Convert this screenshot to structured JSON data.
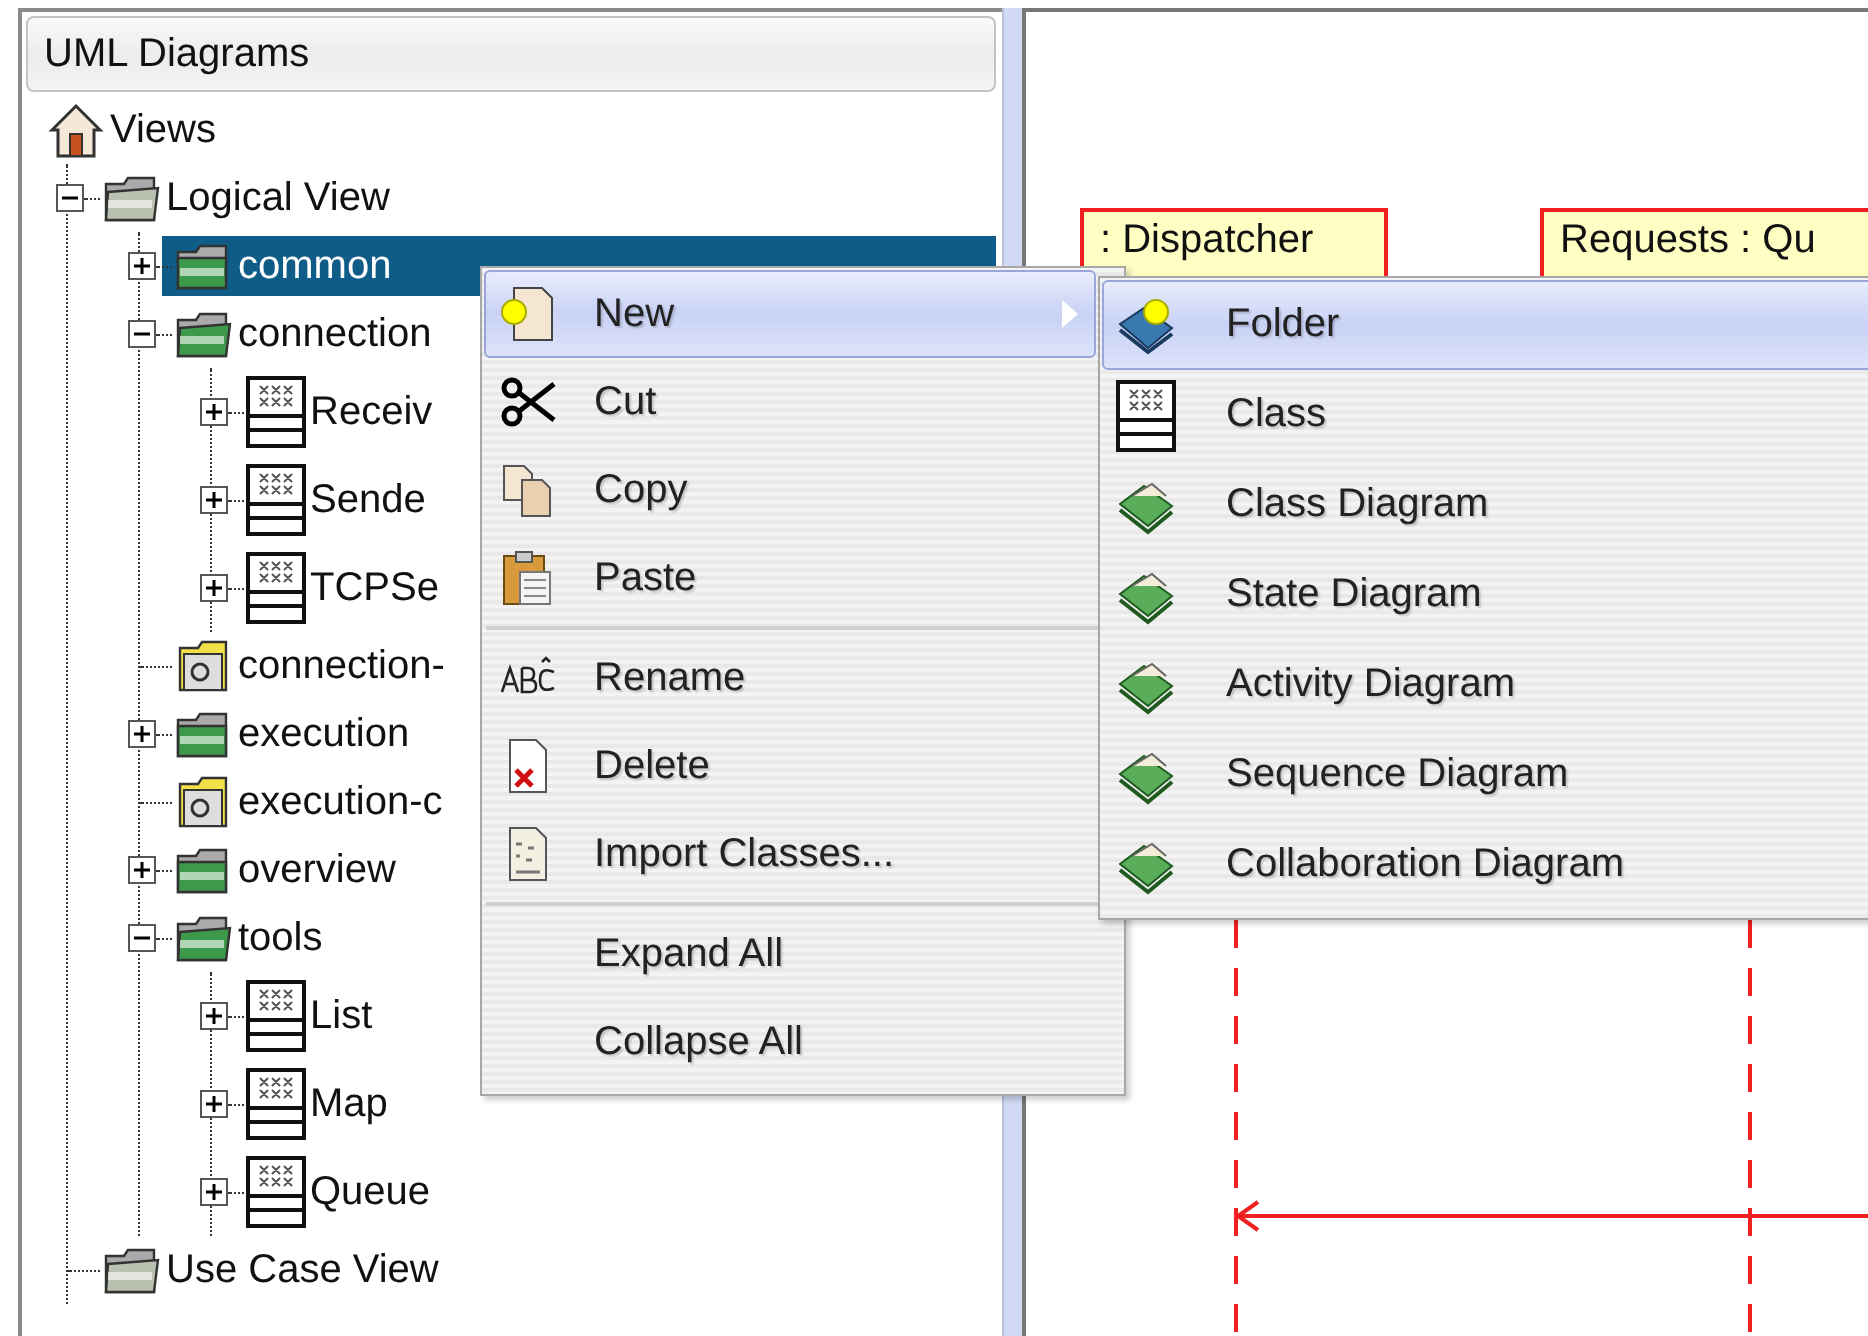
{
  "panel": {
    "title": "UML Diagrams"
  },
  "tree": [
    {
      "label": "Views",
      "kind": "root",
      "selected": false,
      "children": [
        {
          "label": "Logical View",
          "kind": "view",
          "expanded": true,
          "selected": false,
          "children": [
            {
              "label": "common",
              "kind": "package",
              "expanded": false,
              "selected": true
            },
            {
              "label": "connection",
              "kind": "package",
              "expanded": true,
              "selected": false,
              "children": [
                {
                  "label": "Receiv",
                  "kind": "class",
                  "expanded": false,
                  "selected": false
                },
                {
                  "label": "Sende",
                  "kind": "class",
                  "expanded": false,
                  "selected": false
                },
                {
                  "label": "TCPSe",
                  "kind": "class",
                  "expanded": false,
                  "selected": false
                }
              ]
            },
            {
              "label": "connection-",
              "kind": "classes",
              "selected": false
            },
            {
              "label": "execution",
              "kind": "package",
              "expanded": false,
              "selected": false
            },
            {
              "label": "execution-c",
              "kind": "classes",
              "selected": false
            },
            {
              "label": "overview",
              "kind": "package",
              "expanded": false,
              "selected": false
            },
            {
              "label": "tools",
              "kind": "package",
              "expanded": true,
              "selected": false,
              "children": [
                {
                  "label": "List",
                  "kind": "class",
                  "expanded": false,
                  "selected": false
                },
                {
                  "label": "Map",
                  "kind": "class",
                  "expanded": false,
                  "selected": false
                },
                {
                  "label": "Queue",
                  "kind": "class",
                  "expanded": false,
                  "selected": false
                }
              ]
            }
          ]
        },
        {
          "label": "Use Case View",
          "kind": "view",
          "selected": false
        }
      ]
    }
  ],
  "diagram": {
    "lifelines": [
      {
        "label": ": Dispatcher"
      },
      {
        "label": "Requests : Qu"
      }
    ]
  },
  "context_menu": {
    "groups": [
      [
        {
          "label": "New",
          "selected": true,
          "submenu": true
        },
        {
          "label": "Cut",
          "selected": false,
          "submenu": false
        },
        {
          "label": "Copy",
          "selected": false,
          "submenu": false
        },
        {
          "label": "Paste",
          "selected": false,
          "submenu": false
        }
      ],
      [
        {
          "label": "Rename",
          "selected": false,
          "submenu": false
        },
        {
          "label": "Delete",
          "selected": false,
          "submenu": false
        },
        {
          "label": "Import Classes...",
          "selected": false,
          "submenu": false
        }
      ],
      [
        {
          "label": "Expand All",
          "selected": false,
          "submenu": false
        },
        {
          "label": "Collapse All",
          "selected": false,
          "submenu": false
        }
      ]
    ]
  },
  "submenu": {
    "items": [
      {
        "label": "Folder",
        "selected": true
      },
      {
        "label": "Class",
        "selected": false
      },
      {
        "label": "Class Diagram",
        "selected": false
      },
      {
        "label": "State Diagram",
        "selected": false
      },
      {
        "label": "Activity Diagram",
        "selected": false
      },
      {
        "label": "Sequence Diagram",
        "selected": false
      },
      {
        "label": "Collaboration Diagram",
        "selected": false
      }
    ]
  }
}
